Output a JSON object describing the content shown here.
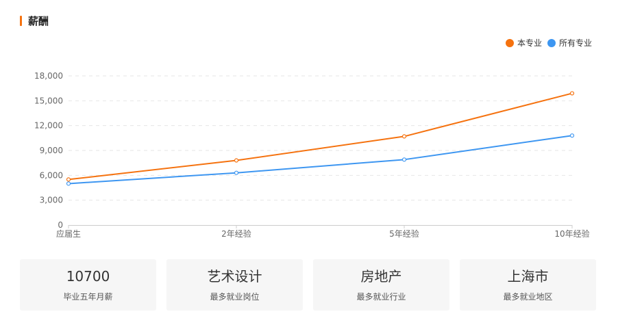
{
  "section": {
    "title": "薪酬",
    "accent_color": "#f5720f"
  },
  "legend": [
    {
      "label": "本专业",
      "color": "#f5720f"
    },
    {
      "label": "所有专业",
      "color": "#3d96f1"
    }
  ],
  "chart_data": {
    "type": "line",
    "x": [
      "应届生",
      "2年经验",
      "5年经验",
      "10年经验"
    ],
    "series": [
      {
        "name": "本专业",
        "color": "#f5720f",
        "values": [
          5500,
          7800,
          10700,
          15900
        ]
      },
      {
        "name": "所有专业",
        "color": "#3d96f1",
        "values": [
          5000,
          6300,
          7900,
          10800
        ]
      }
    ],
    "ylim": [
      0,
      18000
    ],
    "yticks": [
      "0",
      "3,000",
      "6,000",
      "9,000",
      "12,000",
      "15,000",
      "18,000"
    ],
    "grid": true,
    "legend_position": "top-right"
  },
  "cards": [
    {
      "value": "10700",
      "label": "毕业五年月薪"
    },
    {
      "value": "艺术设计",
      "label": "最多就业岗位"
    },
    {
      "value": "房地产",
      "label": "最多就业行业"
    },
    {
      "value": "上海市",
      "label": "最多就业地区"
    }
  ]
}
